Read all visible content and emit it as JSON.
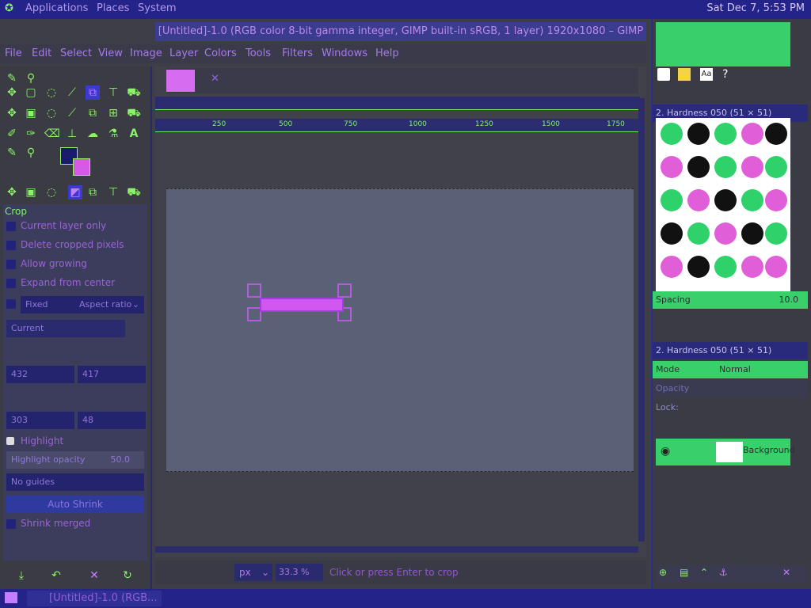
{
  "top_panel": {
    "menus": [
      "Applications",
      "Places",
      "System"
    ],
    "clock": "Sat Dec 7, 5:53 PM"
  },
  "window": {
    "title": "[Untitled]-1.0 (RGB color 8-bit gamma integer, GIMP built-in sRGB, 1 layer) 1920x1080 – GIMP"
  },
  "menubar": [
    "File",
    "Edit",
    "Select",
    "View",
    "Image",
    "Layer",
    "Colors",
    "Tools",
    "Filters",
    "Windows",
    "Help"
  ],
  "tool_options": {
    "title": "Crop",
    "options": [
      "Current layer only",
      "Delete cropped pixels",
      "Allow growing",
      "Expand from center"
    ],
    "fixed_label": "Fixed",
    "fixed_value": "Aspect ratio",
    "current_value": "Current",
    "size_w": "432",
    "size_h": "417",
    "pos_x": "303",
    "pos_y": "48",
    "highlight_label": "Highlight",
    "highlight_opacity_label": "Highlight opacity",
    "highlight_opacity_value": "50.0",
    "guides_label": "No guides",
    "auto_shrink": "Auto Shrink",
    "shrink_merged": "Shrink merged"
  },
  "rulers": {
    "ticks": [
      "250",
      "500",
      "750",
      "1000",
      "1250",
      "1500",
      "1750"
    ]
  },
  "statusbar": {
    "unit": "px",
    "zoom": "33.3 %",
    "message": "Click or press Enter to crop"
  },
  "dock": {
    "brushes_header": "2. Hardness 050 (51 × 51)",
    "brush_tag": "Aa",
    "spacing_label": "Spacing",
    "spacing_value": "10.0",
    "layers_header": "2. Hardness 050 (51 × 51)",
    "mode_label": "Mode",
    "mode_value": "Normal",
    "opacity_label": "Opacity",
    "lock_label": "Lock:",
    "layer_name": "Background"
  },
  "taskbar": {
    "item": "[Untitled]-1.0 (RGB..."
  },
  "colors": {
    "accent_green": "#8cf26c",
    "accent_purple": "#c47dff",
    "panel_blue": "#23238a"
  }
}
